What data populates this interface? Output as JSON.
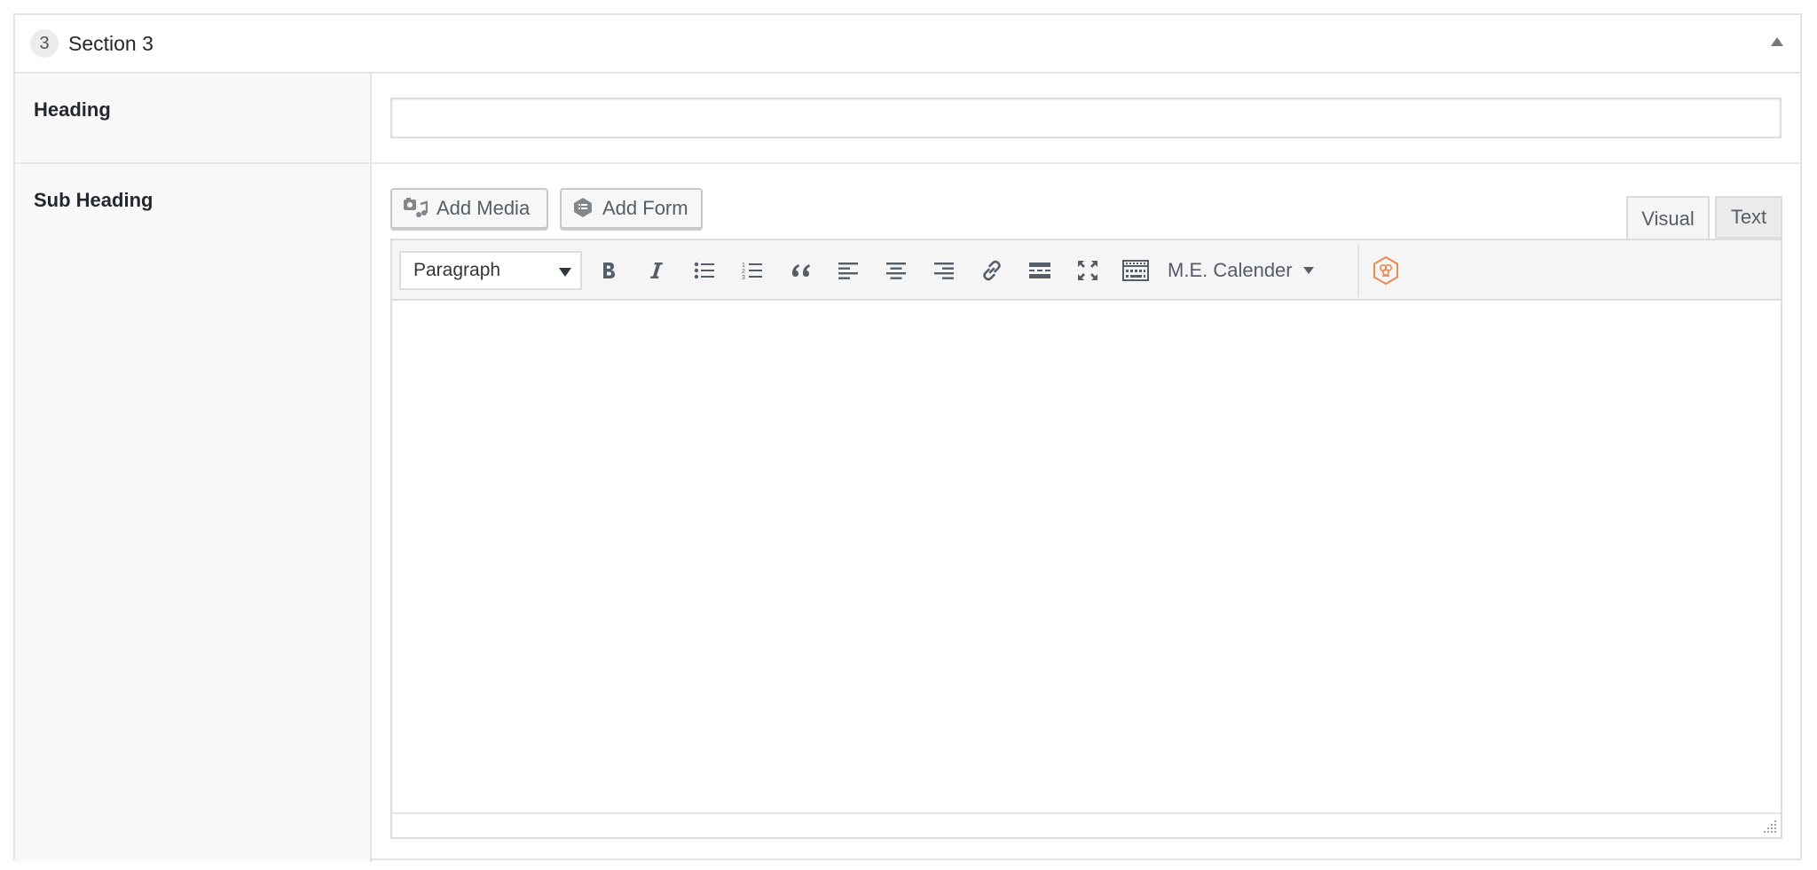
{
  "section": {
    "number": "3",
    "title": "Section 3",
    "collapse_icon": "triangle-up-icon"
  },
  "fields": {
    "heading": {
      "label": "Heading",
      "value": "",
      "placeholder": ""
    },
    "sub_heading": {
      "label": "Sub Heading"
    }
  },
  "editor": {
    "add_media_label": "Add Media",
    "add_form_label": "Add Form",
    "tabs": {
      "visual": "Visual",
      "text": "Text",
      "active": "visual"
    },
    "format_select": "Paragraph",
    "calender_label": "M.E. Calender",
    "toolbar_icons": [
      "bold-icon",
      "italic-icon",
      "bulleted-list-icon",
      "numbered-list-icon",
      "blockquote-icon",
      "align-left-icon",
      "align-center-icon",
      "align-right-icon",
      "link-icon",
      "read-more-icon",
      "fullscreen-icon",
      "toolbar-toggle-icon",
      "plugin-hexagon-icon"
    ],
    "colors": {
      "plugin_accent": "#e88b4d"
    }
  }
}
